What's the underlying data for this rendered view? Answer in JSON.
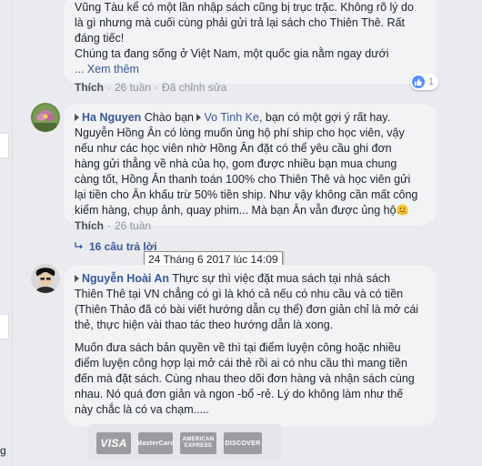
{
  "comment1": {
    "lines": [
      "Vũng Tàu kể có một lần nhập sách cũng bị trục trặc. Không rõ lý do",
      "là gì nhưng mà cuối cùng phải gửi trả lại sách cho Thiên Thê. Rất",
      "đáng tiếc!",
      "Chúng ta đang sống ở Việt Nam, một quốc gia nằm ngay dưới"
    ],
    "see_more": "... Xem thêm",
    "like_label": "Thích",
    "time": "26 tuần",
    "edited": "Đã chỉnh sửa",
    "reaction_count": "1"
  },
  "comment2": {
    "author": "Ha Nguyen",
    "greeting": "Chào bạn",
    "mention": "Vo Tinh Ke",
    "text_first": ", bạn có một gợi ý rất hay.",
    "lines": [
      "Nguyễn Hồng Ân có lòng muốn ủng hộ phí ship cho học viên, vậy",
      "nếu như các học viên nhờ Hồng Ân đặt có thể yêu cầu ghi đơn",
      "hàng gửi thẳng về nhà của họ, gom được nhiều bạn mua chung",
      "càng tốt, Hồng Ân thanh toán 100% cho Thiên Thê và học viên gửi",
      "lại tiền cho Ân khấu trừ 50% tiền ship. Như vậy không cần mất công",
      "kiểm hàng, chụp ảnh, quay phim... Mà bạn Ân vẫn được ủng hộ"
    ],
    "like_label": "Thích",
    "time": "26 tuần",
    "replies": "16 câu trả lời"
  },
  "tooltip": "24 Tháng 6 2017 lúc 14:09",
  "comment3": {
    "author": "Nguyễn Hoài An",
    "first_line": "Thực sự thì việc đặt mua sách tại nhà sách",
    "para1": [
      "Thiên Thê tại VN chẳng có gì là khó cả nếu có nhu cầu và có tiền",
      "(Thiên Thảo đã có bài viết hướng dẫn cụ thể) đơn giản chỉ là mở cái",
      "thẻ, thực hiện vài thao tác theo hướng dẫn là xong."
    ],
    "para2": [
      "Muốn đưa sách bản quyền về thì tại điểm luyện công hoặc nhiều",
      "điểm luyện công hợp lại mở cái thẻ rồi ai có nhu cầu thì mang tiền",
      "đến mà đặt sách. Cùng nhau theo dõi đơn hàng và nhận sách cùng",
      "nhau. Nó quá đơn giản và ngon -bổ -rẻ. Lý do không làm như thế",
      "này chắc là có va chạm....."
    ]
  },
  "cards": [
    "VISA",
    "MasterCard",
    "AMERICAN EXPRESS",
    "DISCOVER"
  ],
  "left_edge_text": "g"
}
